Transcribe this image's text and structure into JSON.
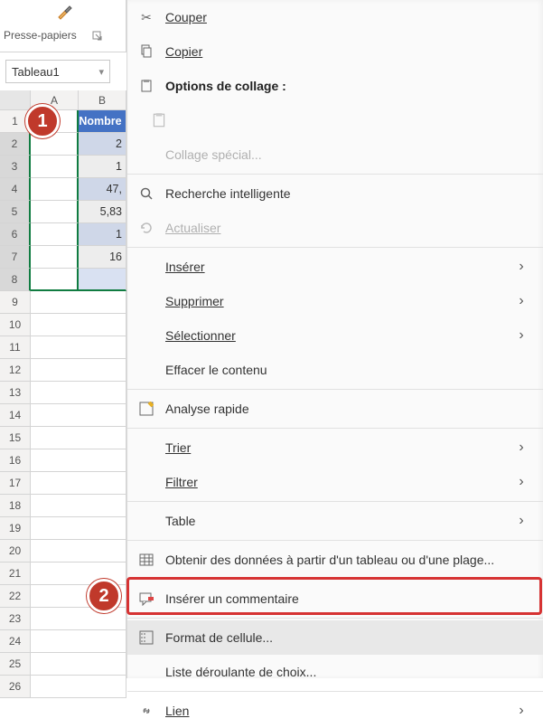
{
  "ribbon": {
    "section_label": "Presse-papiers"
  },
  "name_box": {
    "value": "Tableau1"
  },
  "grid": {
    "col_a": "A",
    "col_b": "B",
    "header_b": "Nombre",
    "rows": [
      "1",
      "2",
      "3",
      "4",
      "5",
      "6",
      "7",
      "8",
      "9",
      "10",
      "11",
      "12",
      "13",
      "14",
      "15",
      "16",
      "17",
      "18",
      "19",
      "20",
      "21",
      "22",
      "23",
      "24",
      "25",
      "26"
    ],
    "values_b": [
      "",
      "2",
      "1",
      "47,",
      "5,83",
      "1",
      "16",
      ""
    ]
  },
  "menu": {
    "cut": "Couper",
    "copy": "Copier",
    "paste_options": "Options de collage :",
    "paste_special": "Collage spécial...",
    "smart_lookup": "Recherche intelligente",
    "refresh": "Actualiser",
    "insert": "Insérer",
    "delete": "Supprimer",
    "select": "Sélectionner",
    "clear": "Effacer le contenu",
    "quick_analysis": "Analyse rapide",
    "sort": "Trier",
    "filter": "Filtrer",
    "table": "Table",
    "get_data": "Obtenir des données à partir d'un tableau ou d'une plage...",
    "insert_comment": "Insérer un commentaire",
    "format_cells": "Format de cellule...",
    "dropdown_list": "Liste déroulante de choix...",
    "link": "Lien"
  },
  "badges": {
    "one": "1",
    "two": "2"
  }
}
